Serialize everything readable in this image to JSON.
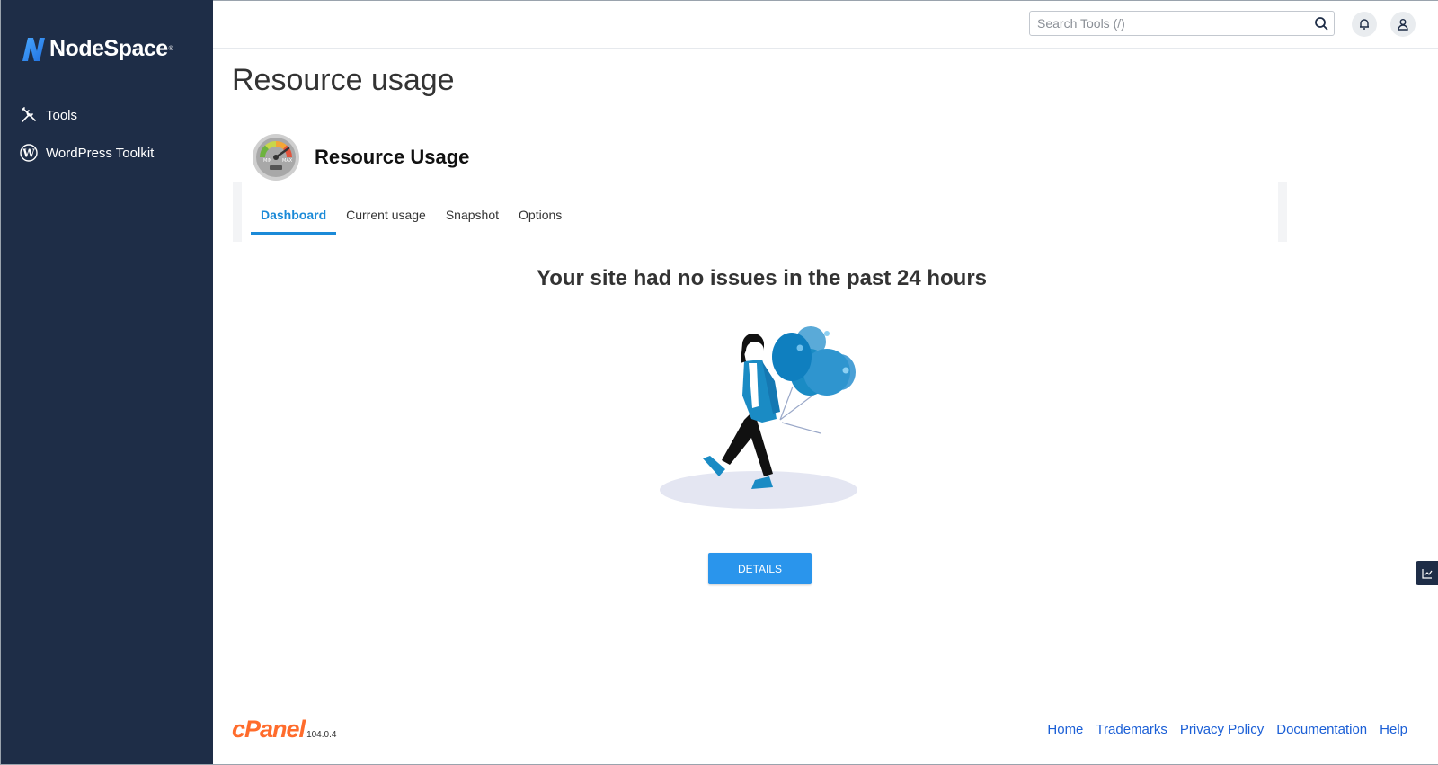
{
  "brand": {
    "name": "NodeSpace",
    "trademark": "®"
  },
  "sidebar": {
    "items": [
      {
        "label": "Tools",
        "icon": "tools-icon"
      },
      {
        "label": "WordPress Toolkit",
        "icon": "wordpress-icon"
      }
    ]
  },
  "topbar": {
    "search_placeholder": "Search Tools (/)",
    "icons": [
      "search-icon",
      "bell-icon",
      "user-icon"
    ]
  },
  "page": {
    "title": "Resource usage",
    "app_title": "Resource Usage",
    "gauge_labels": {
      "min": "MIN",
      "max": "MAX"
    }
  },
  "tabs": [
    {
      "label": "Dashboard",
      "active": true
    },
    {
      "label": "Current usage",
      "active": false
    },
    {
      "label": "Snapshot",
      "active": false
    },
    {
      "label": "Options",
      "active": false
    }
  ],
  "status": {
    "heading": "Your site had no issues in the past 24 hours"
  },
  "details_button": {
    "label": "DETAILS"
  },
  "footer": {
    "logo_text": "cPanel",
    "version": "104.0.4",
    "links": [
      "Home",
      "Trademarks",
      "Privacy Policy",
      "Documentation",
      "Help"
    ]
  },
  "colors": {
    "sidebar_bg": "#1e2d47",
    "accent": "#1b8ad8",
    "button": "#2a95ec",
    "cpanel_orange": "#ff6c2c",
    "link": "#1b5fd6"
  }
}
